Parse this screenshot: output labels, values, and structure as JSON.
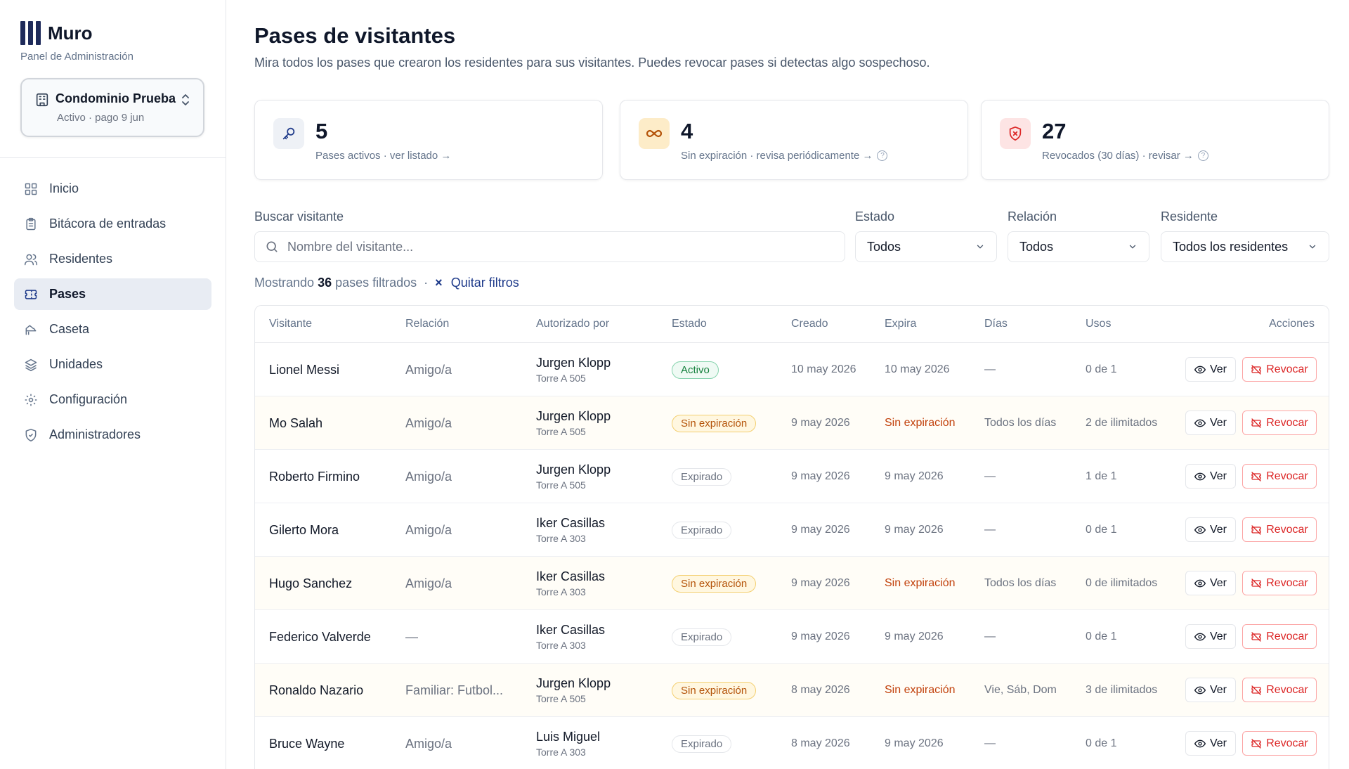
{
  "brand": {
    "name": "Muro",
    "subtitle": "Panel de Administración"
  },
  "condo": {
    "name": "Condominio Prueba",
    "status": "Activo · pago 9 jun"
  },
  "nav": [
    {
      "label": "Inicio",
      "icon": "grid-icon",
      "active": false
    },
    {
      "label": "Bitácora de entradas",
      "icon": "clipboard-icon",
      "active": false
    },
    {
      "label": "Residentes",
      "icon": "users-icon",
      "active": false
    },
    {
      "label": "Pases",
      "icon": "ticket-icon",
      "active": true
    },
    {
      "label": "Caseta",
      "icon": "guardhouse-icon",
      "active": false
    },
    {
      "label": "Unidades",
      "icon": "layers-icon",
      "active": false
    },
    {
      "label": "Configuración",
      "icon": "gear-icon",
      "active": false
    },
    {
      "label": "Administradores",
      "icon": "shield-icon",
      "active": false
    }
  ],
  "page": {
    "title": "Pases de visitantes",
    "subtitle": "Mira todos los pases que crearon los residentes para sus visitantes. Puedes revocar pases si detectas algo sospechoso."
  },
  "stats": [
    {
      "value": "5",
      "label": "Pases activos · ver listado →",
      "icon": "key-icon",
      "color": "#1e3a8a",
      "bg": "#eef1f6",
      "help": false
    },
    {
      "value": "4",
      "label": "Sin expiración · revisa periódicamente →",
      "icon": "infinity-icon",
      "color": "#b45309",
      "bg": "#fdecc8",
      "help": true
    },
    {
      "value": "27",
      "label": "Revocados (30 días) · revisar →",
      "icon": "shield-x-icon",
      "color": "#dc2626",
      "bg": "#fde4e4",
      "help": true
    }
  ],
  "filters": {
    "search_label": "Buscar visitante",
    "search_placeholder": "Nombre del visitante...",
    "estado_label": "Estado",
    "estado_value": "Todos",
    "relacion_label": "Relación",
    "relacion_value": "Todos",
    "residente_label": "Residente",
    "residente_value": "Todos los residentes"
  },
  "results": {
    "prefix": "Mostrando",
    "count": "36",
    "suffix": "pases filtrados",
    "sep": "·",
    "clear_icon": "×",
    "clear_label": "Quitar filtros"
  },
  "table": {
    "headers": [
      "Visitante",
      "Relación",
      "Autorizado por",
      "Estado",
      "Creado",
      "Expira",
      "Días",
      "Usos",
      "Acciones"
    ],
    "view_label": "Ver",
    "revoke_label": "Revocar",
    "rows": [
      {
        "visitor": "Lionel Messi",
        "relation": "Amigo/a",
        "author": "Jurgen Klopp",
        "unit": "Torre A 505",
        "status": "Activo",
        "status_kind": "activo",
        "created": "10 may 2026",
        "expires": "10 may 2026",
        "days": "—",
        "uses": "0 de 1"
      },
      {
        "visitor": "Mo Salah",
        "relation": "Amigo/a",
        "author": "Jurgen Klopp",
        "unit": "Torre A 505",
        "status": "Sin expiración",
        "status_kind": "sinexp",
        "created": "9 may 2026",
        "expires": "Sin expiración",
        "days": "Todos los días",
        "uses": "2 de ilimitados"
      },
      {
        "visitor": "Roberto Firmino",
        "relation": "Amigo/a",
        "author": "Jurgen Klopp",
        "unit": "Torre A 505",
        "status": "Expirado",
        "status_kind": "expirado",
        "created": "9 may 2026",
        "expires": "9 may 2026",
        "days": "—",
        "uses": "1 de 1"
      },
      {
        "visitor": "Gilerto Mora",
        "relation": "Amigo/a",
        "author": "Iker Casillas",
        "unit": "Torre A 303",
        "status": "Expirado",
        "status_kind": "expirado",
        "created": "9 may 2026",
        "expires": "9 may 2026",
        "days": "—",
        "uses": "0 de 1"
      },
      {
        "visitor": "Hugo Sanchez",
        "relation": "Amigo/a",
        "author": "Iker Casillas",
        "unit": "Torre A 303",
        "status": "Sin expiración",
        "status_kind": "sinexp",
        "created": "9 may 2026",
        "expires": "Sin expiración",
        "days": "Todos los días",
        "uses": "0 de ilimitados"
      },
      {
        "visitor": "Federico Valverde",
        "relation": "—",
        "author": "Iker Casillas",
        "unit": "Torre A 303",
        "status": "Expirado",
        "status_kind": "expirado",
        "created": "9 may 2026",
        "expires": "9 may 2026",
        "days": "—",
        "uses": "0 de 1"
      },
      {
        "visitor": "Ronaldo Nazario",
        "relation": "Familiar: Futbol...",
        "author": "Jurgen Klopp",
        "unit": "Torre A 505",
        "status": "Sin expiración",
        "status_kind": "sinexp",
        "created": "8 may 2026",
        "expires": "Sin expiración",
        "days": "Vie, Sáb, Dom",
        "uses": "3 de ilimitados"
      },
      {
        "visitor": "Bruce Wayne",
        "relation": "Amigo/a",
        "author": "Luis Miguel",
        "unit": "Torre A 303",
        "status": "Expirado",
        "status_kind": "expirado",
        "created": "8 may 2026",
        "expires": "9 may 2026",
        "days": "—",
        "uses": "0 de 1"
      }
    ]
  }
}
